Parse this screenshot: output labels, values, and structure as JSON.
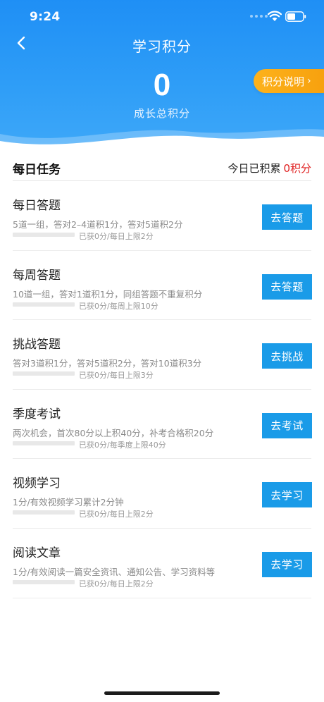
{
  "status": {
    "time": "9:24"
  },
  "header": {
    "title": "学习积分",
    "total_points": "0",
    "total_label": "成长总积分",
    "explain_label": "积分说明",
    "colors": {
      "primary": "#2196F3",
      "accent": "#FBA919"
    }
  },
  "daily": {
    "title": "每日任务",
    "today_label": "今日已积累",
    "today_points": "0积分"
  },
  "tasks": [
    {
      "title": "每日答题",
      "desc": "5道一组，答对2–4道积1分，答对5道积2分",
      "progress_text": "已获0分/每日上限2分",
      "progress": 0,
      "button": "去答题"
    },
    {
      "title": "每周答题",
      "desc": "10道一组，答对1道积1分，同组答题不重复积分",
      "progress_text": "已获0分/每周上限10分",
      "progress": 0,
      "button": "去答题"
    },
    {
      "title": "挑战答题",
      "desc": "答对3道积1分，答对5道积2分，答对10道积3分",
      "progress_text": "已获0分/每日上限3分",
      "progress": 0,
      "button": "去挑战"
    },
    {
      "title": "季度考试",
      "desc": "两次机会，首次80分以上积40分，补考合格积20分",
      "progress_text": "已获0分/每季度上限40分",
      "progress": 0,
      "button": "去考试"
    },
    {
      "title": "视频学习",
      "desc": "1分/有效视频学习累计2分钟",
      "progress_text": "已获0分/每日上限2分",
      "progress": 0,
      "button": "去学习"
    },
    {
      "title": "阅读文章",
      "desc": "1分/有效阅读一篇安全资讯、通知公告、学习资料等",
      "progress_text": "已获0分/每日上限2分",
      "progress": 0,
      "button": "去学习"
    }
  ]
}
